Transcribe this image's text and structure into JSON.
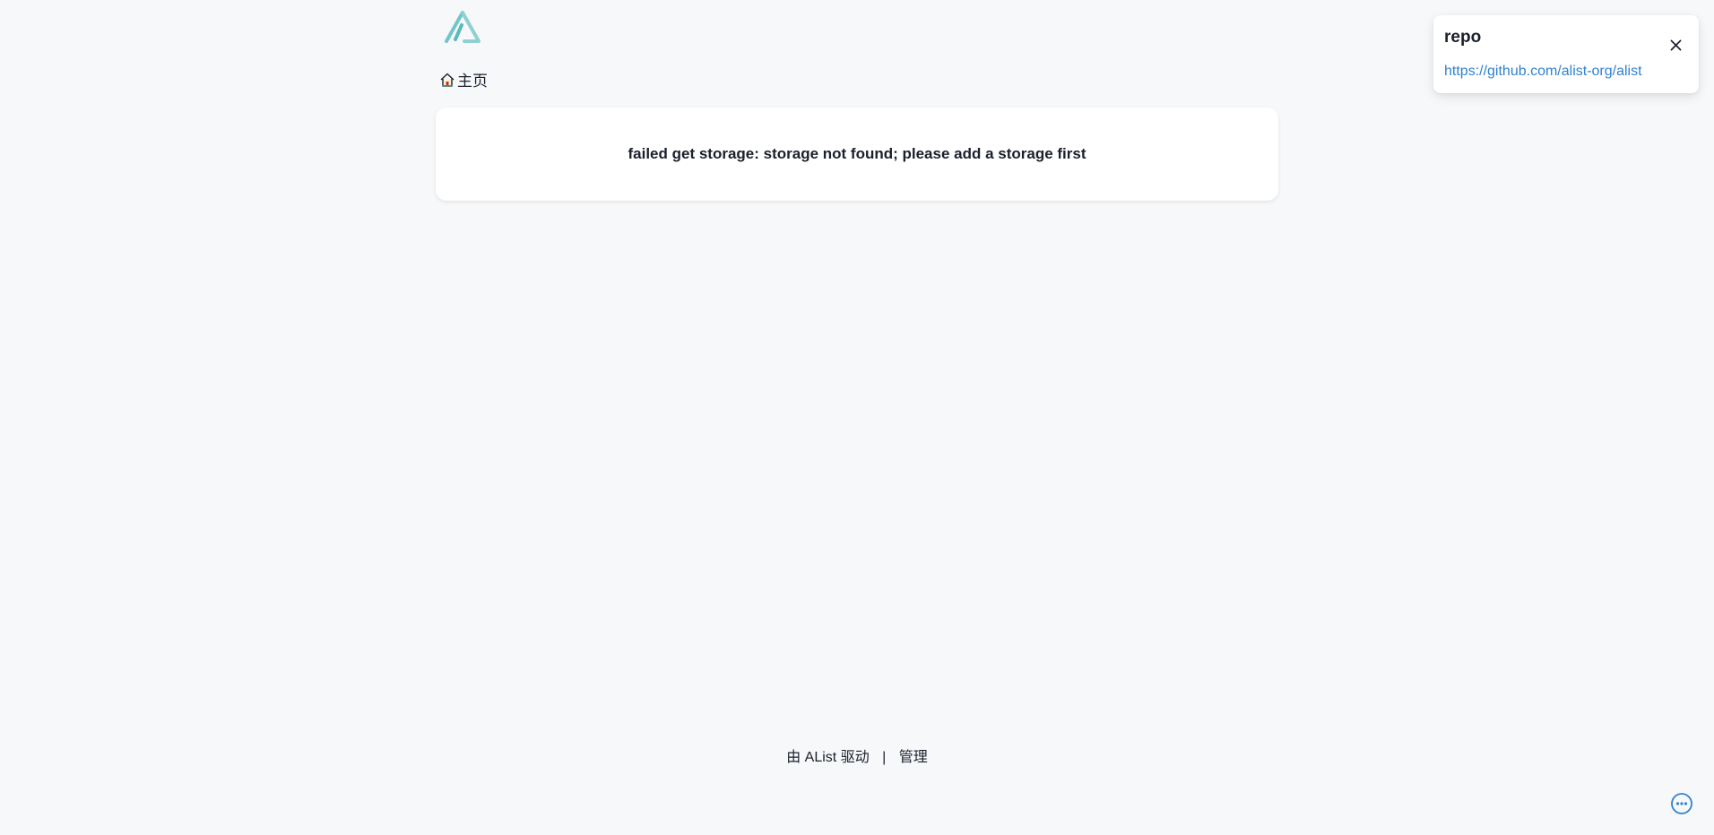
{
  "breadcrumb": {
    "home_label": "主页"
  },
  "message": {
    "text": "failed get storage: storage not found; please add a storage first"
  },
  "notification": {
    "title": "repo",
    "link_text": "https://github.com/alist-org/alist",
    "link_href": "https://github.com/alist-org/alist"
  },
  "footer": {
    "powered_prefix": "由 ",
    "powered_name": "AList",
    "powered_suffix": " 驱动",
    "separator": "|",
    "manage_label": "管理"
  },
  "icons": {
    "logo": "alist-logo",
    "home": "home-icon",
    "close": "close-icon",
    "more": "more-icon"
  },
  "colors": {
    "background": "#f7f8fa",
    "logo": "#70c6c9",
    "link": "#3182ce"
  }
}
